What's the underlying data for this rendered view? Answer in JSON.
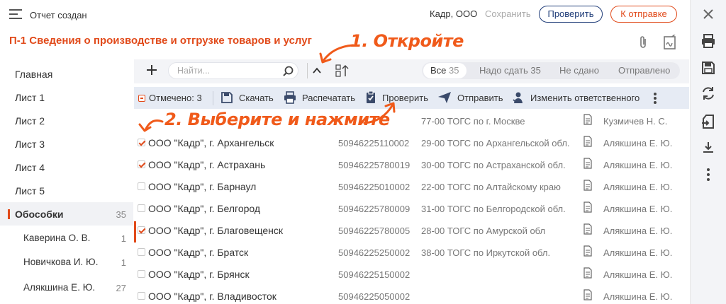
{
  "header": {
    "status_title": "Отчет создан",
    "org": "Кадр, ООО",
    "save_label": "Сохранить",
    "check_label": "Проверить",
    "send_label": "К отправке"
  },
  "report": {
    "title": "П-1 Сведения о производстве и отгрузке товаров и услуг"
  },
  "nav": {
    "items": [
      {
        "label": "Главная"
      },
      {
        "label": "Лист 1"
      },
      {
        "label": "Лист 2"
      },
      {
        "label": "Лист 3"
      },
      {
        "label": "Лист 4"
      },
      {
        "label": "Лист 5"
      },
      {
        "label": "Обособки",
        "count": "35"
      },
      {
        "label": "Каверина О. В.",
        "count": "1"
      },
      {
        "label": "Новичкова И. Ю.",
        "count": "1"
      },
      {
        "label": "Алякшина Е. Ю.",
        "count": "27"
      }
    ]
  },
  "toolbar": {
    "search_placeholder": "Найти...",
    "filters": [
      {
        "label": "Все",
        "count": "35"
      },
      {
        "label": "Надо сдать 35"
      },
      {
        "label": "Не сдано"
      },
      {
        "label": "Отправлено"
      }
    ]
  },
  "actions": {
    "selected": "Отмечено: 3",
    "download": "Скачать",
    "print": "Распечатать",
    "check": "Проверить",
    "send": "Отправить",
    "change_resp": "Изменить ответственного"
  },
  "rows": [
    {
      "name": "",
      "inn": "",
      "tax": "77-00 ТОГС по г. Москве",
      "resp": "Кузмичев Н. С.",
      "checked": false,
      "marked": false
    },
    {
      "name": "ООО \"Кадр\", г. Архангельск",
      "inn": "50946225110002",
      "tax": "29-00 ТОГС по Архангельской обл.",
      "resp": "Алякшина Е. Ю.",
      "checked": true,
      "marked": false
    },
    {
      "name": "ООО \"Кадр\", г. Астрахань",
      "inn": "50946225780019",
      "tax": "30-00 ТОГС по Астраханской обл.",
      "resp": "Алякшина Е. Ю.",
      "checked": true,
      "marked": false
    },
    {
      "name": "ООО \"Кадр\", г. Барнаул",
      "inn": "50946225010002",
      "tax": "22-00 ТОГС по Алтайскому краю",
      "resp": "Алякшина Е. Ю.",
      "checked": false,
      "marked": false
    },
    {
      "name": "ООО \"Кадр\", г. Белгород",
      "inn": "50946225780009",
      "tax": "31-00 ТОГС по Белгородской обл.",
      "resp": "Алякшина Е. Ю.",
      "checked": false,
      "marked": false
    },
    {
      "name": "ООО \"Кадр\", г. Благовещенск",
      "inn": "50946225780005",
      "tax": "28-00 ТОГС по Амурской обл",
      "resp": "Алякшина Е. Ю.",
      "checked": true,
      "marked": true
    },
    {
      "name": "ООО \"Кадр\", г. Братск",
      "inn": "50946225250002",
      "tax": "38-00 ТОГС по Иркутской обл.",
      "resp": "Алякшина Е. Ю.",
      "checked": false,
      "marked": false
    },
    {
      "name": "ООО \"Кадр\", г. Брянск",
      "inn": "50946225150002",
      "tax": "",
      "resp": "Алякшина Е. Ю.",
      "checked": false,
      "marked": false
    },
    {
      "name": "ООО \"Кадр\", г. Владивосток",
      "inn": "50946225050002",
      "tax": "",
      "resp": "Алякшина Е. Ю.",
      "checked": false,
      "marked": false
    }
  ],
  "annotations": {
    "step1": "1. Откройте",
    "step2": "2. Выберите и нажмите"
  },
  "colors": {
    "accent": "#e14a1a",
    "brand_blue": "#1f3c78",
    "annotation": "#f05a1a"
  }
}
